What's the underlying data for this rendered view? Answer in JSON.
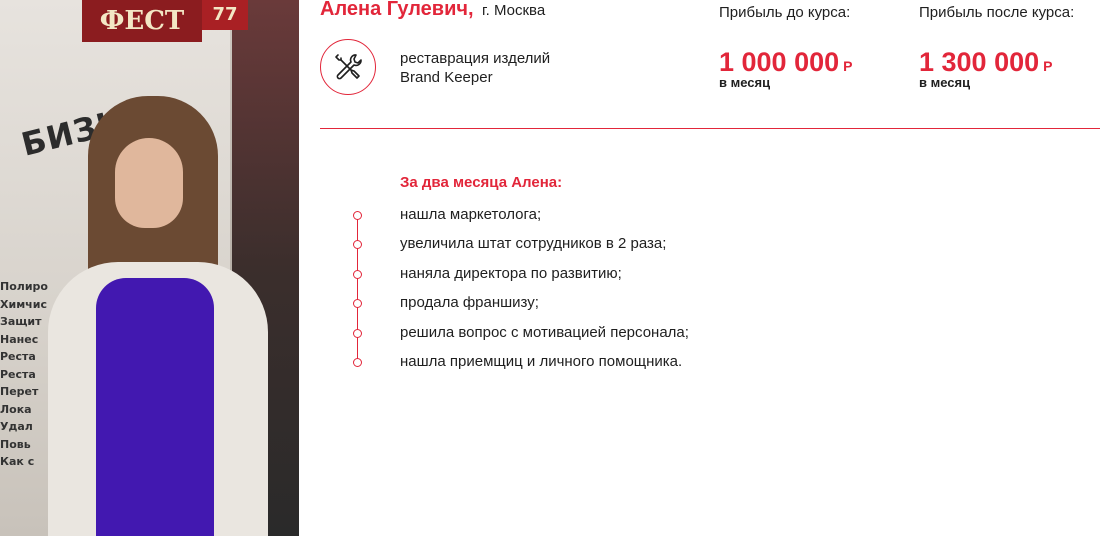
{
  "person": {
    "name": "Алена Гулевич,",
    "city": "г. Москва",
    "photo_icon": "portrait-photo",
    "photo_signage": {
      "fest": "ФЕСТ",
      "fest_number": "77",
      "banner_word": "БИЗН!!!",
      "side_list": [
        "Полиро",
        "Химчис",
        "Защит",
        "Нанес",
        "Реста",
        "Реста",
        "Перет",
        "Лока",
        "Удал",
        "Повь",
        "Как с"
      ]
    }
  },
  "business": {
    "icon": "tools-icon",
    "line1": "реставрация изделий",
    "line2": "Brand Keeper"
  },
  "profit_before": {
    "label": "Прибыль до курса:",
    "amount": "1 000 000",
    "currency": "Р",
    "period": "в месяц"
  },
  "profit_after": {
    "label": "Прибыль после курса:",
    "amount": "1 300 000",
    "currency": "Р",
    "period": "в месяц"
  },
  "results": {
    "heading": "За два месяца Алена:",
    "items": [
      "нашла маркетолога;",
      "увеличила штат сотрудников в 2 раза;",
      "наняла директора по развитию;",
      "продала франшизу;",
      "решила вопрос с мотивацией персонала;",
      "нашла приемщиц и личного помощника."
    ]
  },
  "colors": {
    "accent": "#e2263a",
    "text": "#1f1f1f",
    "dress": "#4218b0"
  }
}
